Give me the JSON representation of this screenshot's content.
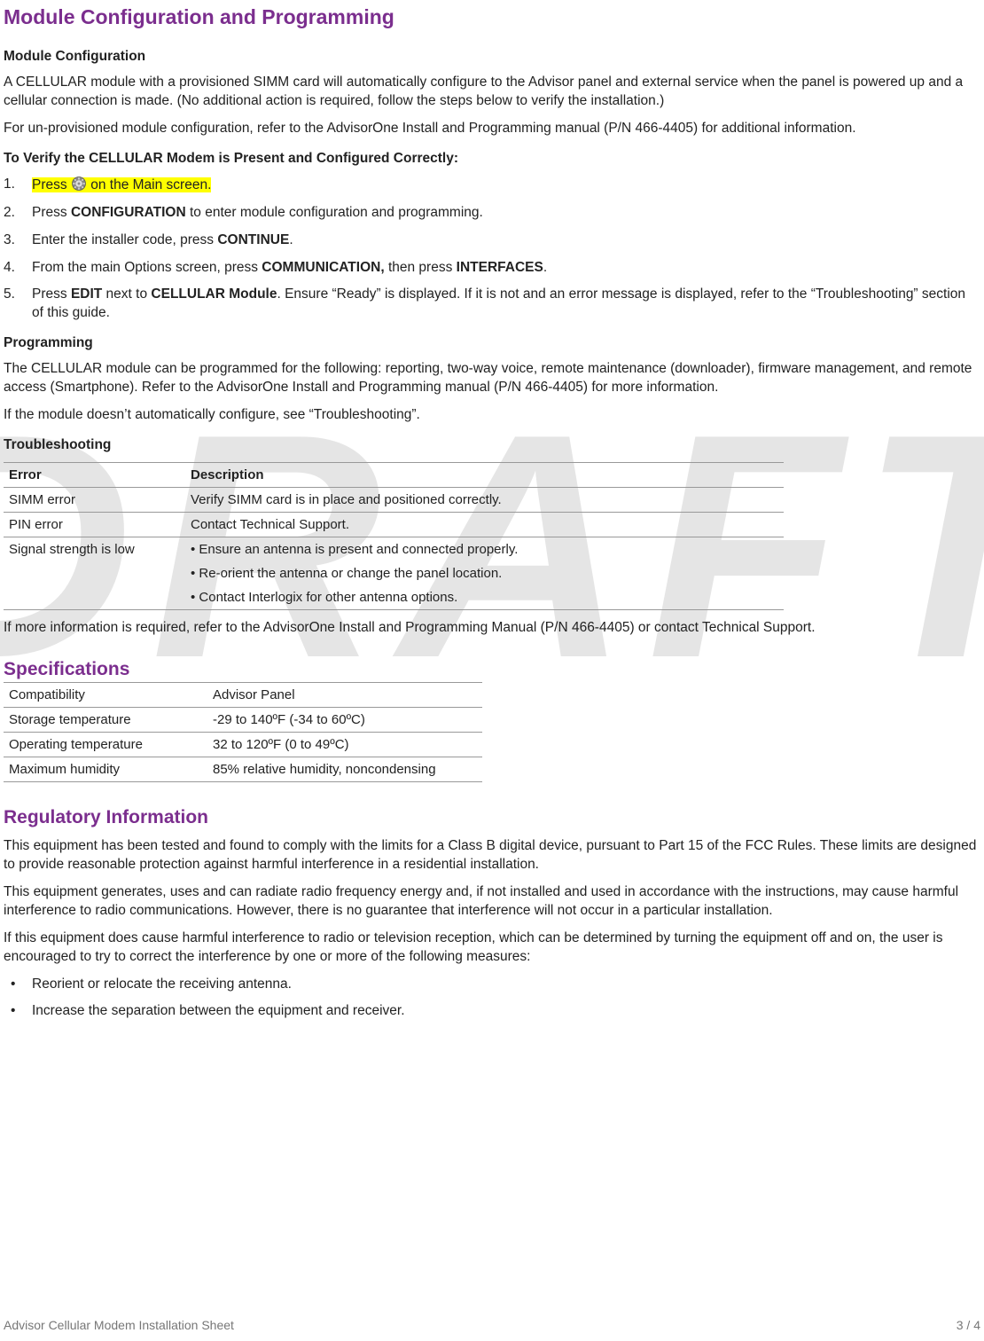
{
  "watermark": "DRAFT",
  "title": "Module Configuration and Programming",
  "sec_module_config": {
    "heading": "Module Configuration",
    "p1": "A CELLULAR module with a provisioned SIMM card will automatically configure to the Advisor panel and external service when the panel is powered up and a cellular connection is made. (No additional action is required, follow the steps below to verify the installation.)",
    "p2": "For un-provisioned module configuration, refer to the AdvisorOne Install and Programming manual (P/N 466-4405) for additional information."
  },
  "verify": {
    "heading": "To Verify the CELLULAR Modem is Present and Configured Correctly:",
    "step1_a": "Press ",
    "step1_b": " on the Main screen.",
    "step2_a": "Press ",
    "step2_b": "CONFIGURATION",
    "step2_c": " to enter module configuration and programming.",
    "step3_a": "Enter the installer code, press ",
    "step3_b": "CONTINUE",
    "step3_c": ".",
    "step4_a": "From the main Options screen, press ",
    "step4_b": "COMMUNICATION,",
    "step4_c": " then press ",
    "step4_d": "INTERFACES",
    "step4_e": ".",
    "step5_a": "Press ",
    "step5_b": "EDIT",
    "step5_c": " next to ",
    "step5_d": "CELLULAR Module",
    "step5_e": ".  Ensure “Ready” is displayed.  If it is not and an error message is displayed, refer to the “Troubleshooting” section of this guide."
  },
  "programming": {
    "heading": "Programming",
    "p1": "The CELLULAR module can be programmed for the following: reporting, two-way voice, remote maintenance (downloader), firmware management, and remote access (Smartphone).  Refer to the AdvisorOne Install and Programming manual (P/N 466-4405) for more information.",
    "p2": "If the module doesn’t automatically configure, see “Troubleshooting”."
  },
  "troubleshooting": {
    "heading": "Troubleshooting",
    "col_error": "Error",
    "col_desc": "Description",
    "rows": [
      {
        "error": "SIMM error",
        "desc": "Verify SIMM card is in place and positioned correctly."
      },
      {
        "error": "PIN error",
        "desc": "Contact Technical Support."
      }
    ],
    "signal_row": {
      "error": "Signal strength is low",
      "b1": "• Ensure an antenna is present and connected properly.",
      "b2": "• Re-orient the antenna or change the panel location.",
      "b3": "• Contact Interlogix for other antenna options."
    },
    "after": "If more information is required, refer to the AdvisorOne Install and Programming Manual (P/N 466-4405) or contact Technical Support."
  },
  "specifications": {
    "heading": "Specifications",
    "rows": [
      {
        "k": "Compatibility",
        "v": "Advisor Panel"
      },
      {
        "k": "Storage temperature",
        "v": "-29 to 140ºF (-34 to 60ºC)"
      },
      {
        "k": "Operating temperature",
        "v": "32 to 120ºF (0 to 49ºC)"
      },
      {
        "k": "Maximum humidity",
        "v": "85% relative humidity, noncondensing"
      }
    ]
  },
  "regulatory": {
    "heading": "Regulatory Information",
    "p1": "This equipment has been tested and found to comply with the limits for a Class B digital device, pursuant to Part 15 of the FCC Rules. These limits are designed to provide reasonable protection against harmful interference in a residential installation.",
    "p2": "This equipment generates, uses and can radiate radio frequency energy and, if not installed and used in accordance with the instructions, may cause harmful interference to radio communications. However, there is no guarantee that interference will not occur in a particular installation.",
    "p3": "If this equipment does cause harmful interference to radio or television reception, which can be determined by turning the equipment off and on, the user is encouraged to try to correct the interference by one or more of the following measures:",
    "bullets": [
      "Reorient or relocate the receiving antenna.",
      "Increase the separation between the equipment and receiver."
    ]
  },
  "footer": {
    "left": "Advisor Cellular Modem Installation Sheet",
    "right": "3 / 4"
  }
}
